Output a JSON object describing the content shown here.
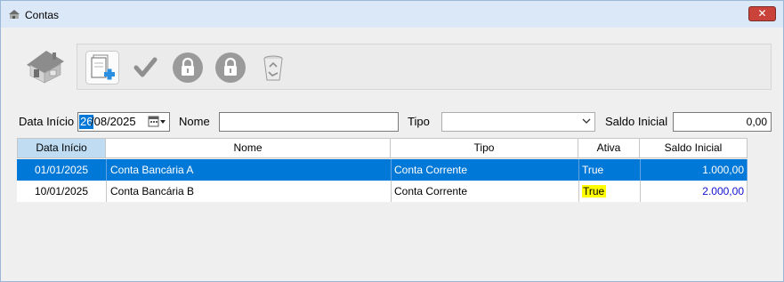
{
  "window": {
    "title": "Contas",
    "close_label": "✕"
  },
  "toolbar": {
    "buttons": [
      {
        "name": "new",
        "icon": "new-document-icon"
      },
      {
        "name": "confirm",
        "icon": "checkmark-icon"
      },
      {
        "name": "lock",
        "icon": "lock-icon"
      },
      {
        "name": "lock-alt",
        "icon": "lock-icon"
      },
      {
        "name": "delete",
        "icon": "recycle-bin-icon"
      }
    ]
  },
  "filters": {
    "data_inicio_label": "Data Início",
    "date_day": "26",
    "date_rest": "/08/2025",
    "nome_label": "Nome",
    "nome_value": "",
    "tipo_label": "Tipo",
    "tipo_value": "",
    "saldo_label": "Saldo Inicial",
    "saldo_value": "0,00"
  },
  "grid": {
    "headers": [
      "Data Início",
      "Nome",
      "Tipo",
      "Ativa",
      "Saldo Inicial"
    ],
    "rows": [
      {
        "data": "01/01/2025",
        "nome": "Conta Bancária A",
        "tipo": "Conta Corrente",
        "ativa": "True",
        "saldo": "1.000,00"
      },
      {
        "data": "10/01/2025",
        "nome": "Conta Bancária B",
        "tipo": "Conta Corrente",
        "ativa": "True",
        "saldo": "2.000,00"
      }
    ]
  },
  "colors": {
    "selection": "#0078d7",
    "highlight": "#ffff00",
    "titlebar": "#dbe8f7",
    "close": "#c9433b"
  }
}
